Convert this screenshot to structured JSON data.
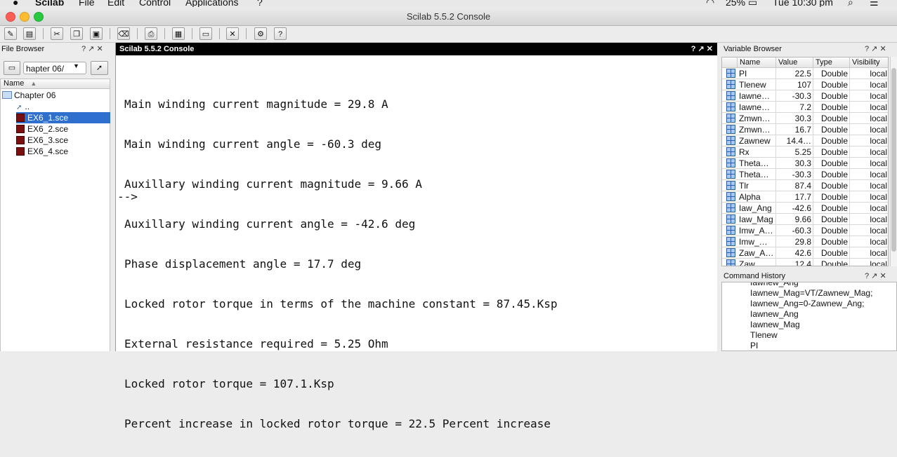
{
  "menubar": {
    "app": "Scilab",
    "menus": [
      "File",
      "Edit",
      "Control",
      "Applications",
      "?"
    ],
    "battery": "25%",
    "clock": "Tue 10:30 pm"
  },
  "window": {
    "title": "Scilab 5.5.2 Console"
  },
  "file_browser": {
    "title": "File Browser",
    "path": "hapter 06/",
    "column": "Name",
    "folder": "Chapter 06",
    "parent": "..",
    "files": [
      "EX6_1.sce",
      "EX6_2.sce",
      "EX6_3.sce",
      "EX6_4.sce"
    ],
    "selected_index": 0
  },
  "console": {
    "title": "Scilab 5.5.2 Console",
    "lines": [
      "Main winding current magnitude = 29.8 A",
      "Main winding current angle = -60.3 deg",
      "Auxillary winding current magnitude = 9.66 A",
      "Auxillary winding current angle = -42.6 deg",
      "Phase displacement angle = 17.7 deg",
      "Locked rotor torque in terms of the machine constant = 87.45.Ksp",
      "External resistance required = 5.25 Ohm",
      "Locked rotor torque = 107.1.Ksp",
      "Percent increase in locked rotor torque = 22.5 Percent increase"
    ],
    "prompt": "-->"
  },
  "variable_browser": {
    "title": "Variable Browser",
    "columns": [
      "Name",
      "Value",
      "Type",
      "Visibility"
    ],
    "rows": [
      {
        "name": "PI",
        "value": "22.5",
        "type": "Double",
        "visibility": "local"
      },
      {
        "name": "Tlenew",
        "value": "107",
        "type": "Double",
        "visibility": "local"
      },
      {
        "name": "Iawne…",
        "value": "-30.3",
        "type": "Double",
        "visibility": "local"
      },
      {
        "name": "Iawne…",
        "value": "7.2",
        "type": "Double",
        "visibility": "local"
      },
      {
        "name": "Zmwn…",
        "value": "30.3",
        "type": "Double",
        "visibility": "local"
      },
      {
        "name": "Zmwn…",
        "value": "16.7",
        "type": "Double",
        "visibility": "local"
      },
      {
        "name": "Zawnew",
        "value": "14.4…",
        "type": "Double",
        "visibility": "local"
      },
      {
        "name": "Rx",
        "value": "5.25",
        "type": "Double",
        "visibility": "local"
      },
      {
        "name": "Theta…",
        "value": "30.3",
        "type": "Double",
        "visibility": "local"
      },
      {
        "name": "Theta…",
        "value": "-30.3",
        "type": "Double",
        "visibility": "local"
      },
      {
        "name": "Tlr",
        "value": "87.4",
        "type": "Double",
        "visibility": "local"
      },
      {
        "name": "Alpha",
        "value": "17.7",
        "type": "Double",
        "visibility": "local"
      },
      {
        "name": "Iaw_Ang",
        "value": "-42.6",
        "type": "Double",
        "visibility": "local"
      },
      {
        "name": "Iaw_Mag",
        "value": "9.66",
        "type": "Double",
        "visibility": "local"
      },
      {
        "name": "Imw_A…",
        "value": "-60.3",
        "type": "Double",
        "visibility": "local"
      },
      {
        "name": "Imw_…",
        "value": "29.8",
        "type": "Double",
        "visibility": "local"
      },
      {
        "name": "Zaw_A…",
        "value": "42.6",
        "type": "Double",
        "visibility": "local"
      },
      {
        "name": "Zaw…",
        "value": "12.4",
        "type": "Double",
        "visibility": "local"
      }
    ]
  },
  "command_history": {
    "title": "Command History",
    "lines": [
      "Iawnew_Ang",
      "Iawnew_Mag=VT/Zawnew_Mag;",
      "Iawnew_Ang=0-Zawnew_Ang;",
      "Iawnew_Ang",
      "Iawnew_Mag",
      "Tlenew",
      "PI"
    ]
  },
  "panel_buttons": "? ↗ ✕"
}
